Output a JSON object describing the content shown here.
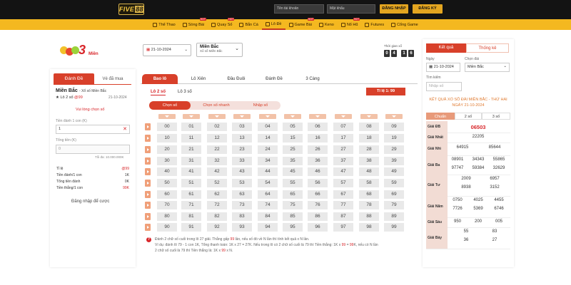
{
  "header": {
    "logo_text": "FIVE",
    "logo_num": "88",
    "username_placeholder": "Tên tài khoản",
    "password_placeholder": "Mật khẩu",
    "login_label": "ĐĂNG NHẬP",
    "register_label": "ĐĂNG KÝ"
  },
  "nav": [
    {
      "label": "Thể Thao",
      "icon": "sports-icon",
      "tag": ""
    },
    {
      "label": "Sòng Bài",
      "icon": "casino-icon",
      "tag": "HOT"
    },
    {
      "label": "Quay Số",
      "icon": "lottery-icon",
      "tag": "HOT"
    },
    {
      "label": "Bắn Cá",
      "icon": "fish-icon",
      "tag": ""
    },
    {
      "label": "Lô Đề",
      "icon": "lode-icon",
      "tag": ""
    },
    {
      "label": "Game Bài",
      "icon": "cards-icon",
      "tag": "HOT"
    },
    {
      "label": "Keno",
      "icon": "keno-icon",
      "tag": ""
    },
    {
      "label": "Nổ Hũ",
      "icon": "jackpot-icon",
      "tag": "HOT"
    },
    {
      "label": "Futures",
      "icon": "futures-icon",
      "tag": ""
    },
    {
      "label": "Cổng Game",
      "icon": "gamegate-icon",
      "tag": ""
    }
  ],
  "sub": {
    "logo_mien": "Miền",
    "logo_3": "3",
    "date": "21-10-2024",
    "region_title": "Miền Bắc",
    "region_sub": "Xổ số Miền Bắc",
    "countdown_label": "Thời gian xổ",
    "countdown": [
      "0",
      "4",
      "1",
      "6"
    ]
  },
  "left": {
    "tab1": "Đánh Đề",
    "tab2": "Vé đã mua",
    "region": "Miền Bắc",
    "region_sub": "- Xổ số Miền Bắc",
    "bet_type": "Lô 2 số",
    "bet_odds": "@99",
    "date": "21-10-2024",
    "choose_prompt": "Vui lòng chọn số",
    "per_unit_label": "Tiền đánh 1 con (K)",
    "per_unit_value": "1",
    "total_label": "Tổng tiền (K)",
    "total_value": "0",
    "max_note": "Tối đa: 10.000.000K",
    "rows": [
      {
        "k": "Tỉ lệ",
        "v": "@99",
        "red": true
      },
      {
        "k": "Tiền đánh/1 con",
        "v": "1K",
        "red": false
      },
      {
        "k": "Tổng tiền đánh",
        "v": "0K",
        "red": false
      },
      {
        "k": "Tiền thắng/1 con",
        "v": "99K",
        "red": true
      }
    ],
    "login_to_bet": "Đăng nhập để cược"
  },
  "center": {
    "tabs": [
      "Bao lô",
      "Lô Xiên",
      "Đầu Đuôi",
      "Đánh Đề",
      "3 Càng"
    ],
    "sub_tabs": [
      "Lô 2 số",
      "Lô 3 số"
    ],
    "rate": "Tỉ lệ 1: 99",
    "modes": [
      "Chọn số",
      "Chọn số nhanh",
      "Nhập số"
    ],
    "numbers": [
      [
        "00",
        "01",
        "02",
        "03",
        "04",
        "05",
        "06",
        "07",
        "08",
        "09"
      ],
      [
        "10",
        "11",
        "12",
        "13",
        "14",
        "15",
        "16",
        "17",
        "18",
        "19"
      ],
      [
        "20",
        "21",
        "22",
        "23",
        "24",
        "25",
        "26",
        "27",
        "28",
        "29"
      ],
      [
        "30",
        "31",
        "32",
        "33",
        "34",
        "35",
        "36",
        "37",
        "38",
        "39"
      ],
      [
        "40",
        "41",
        "42",
        "43",
        "44",
        "45",
        "46",
        "47",
        "48",
        "49"
      ],
      [
        "50",
        "51",
        "52",
        "53",
        "54",
        "55",
        "56",
        "57",
        "58",
        "59"
      ],
      [
        "60",
        "61",
        "62",
        "63",
        "64",
        "65",
        "66",
        "67",
        "68",
        "69"
      ],
      [
        "70",
        "71",
        "72",
        "73",
        "74",
        "75",
        "76",
        "77",
        "78",
        "79"
      ],
      [
        "80",
        "81",
        "82",
        "83",
        "84",
        "85",
        "86",
        "87",
        "88",
        "89"
      ],
      [
        "90",
        "91",
        "92",
        "93",
        "94",
        "95",
        "96",
        "97",
        "98",
        "99"
      ]
    ],
    "note1a": "Đánh 2 chữ số cuối trong lô 27 giải. Thắng gấp ",
    "note1b": "99",
    "note1c": " lần, nếu số đó về N lần thì tính kết quả x N lần.",
    "note2a": "Ví dụ: đánh lô 79 - 1 con 1K, Tổng thanh toán: 1K x 27 = 27K. Nếu trong lô có 2 chữ số cuối là 79 thì Tiền thắng: 1K x ",
    "note2b": "99",
    "note2c": " = ",
    "note2d": "99",
    "note2e": "K, nếu có N lần",
    "note3a": "2 chữ số cuối là 79 thì Tiền thắng là: 1K x ",
    "note3b": "99",
    "note3c": " x N."
  },
  "right": {
    "tab1": "Kết quả",
    "tab2": "Thống kê",
    "date_label": "Ngày",
    "date_value": "21-10-2024",
    "region_label": "Chọn đài",
    "region_value": "Miền Bắc",
    "search_label": "Tìm kiếm",
    "search_placeholder": "Nhập số",
    "result_title": "KẾT QUẢ XỔ SỐ ĐÀI MIỀN BẮC - THỨ HAI NGÀY 21-10-2024",
    "view_tabs": [
      "Chuẩn",
      "2 số",
      "3 số"
    ],
    "prizes": [
      {
        "name": "Giải ĐB",
        "values": [
          "06503"
        ]
      },
      {
        "name": "Giải Nhất",
        "values": [
          "22205"
        ]
      },
      {
        "name": "Giải Nhì",
        "values": [
          "64915",
          "85644"
        ]
      },
      {
        "name": "Giải Ba",
        "values": [
          "08901",
          "34343",
          "55865",
          "97747",
          "59384",
          "32629"
        ]
      },
      {
        "name": "Giải Tư",
        "values": [
          "2009",
          "6957",
          "8938",
          "3152"
        ]
      },
      {
        "name": "Giải Năm",
        "values": [
          "0750",
          "4025",
          "4455",
          "7726",
          "5369",
          "6746"
        ]
      },
      {
        "name": "Giải Sáu",
        "values": [
          "950",
          "200",
          "005"
        ]
      },
      {
        "name": "Giải Bảy",
        "values": [
          "55",
          "83",
          "36",
          "27"
        ]
      }
    ]
  }
}
